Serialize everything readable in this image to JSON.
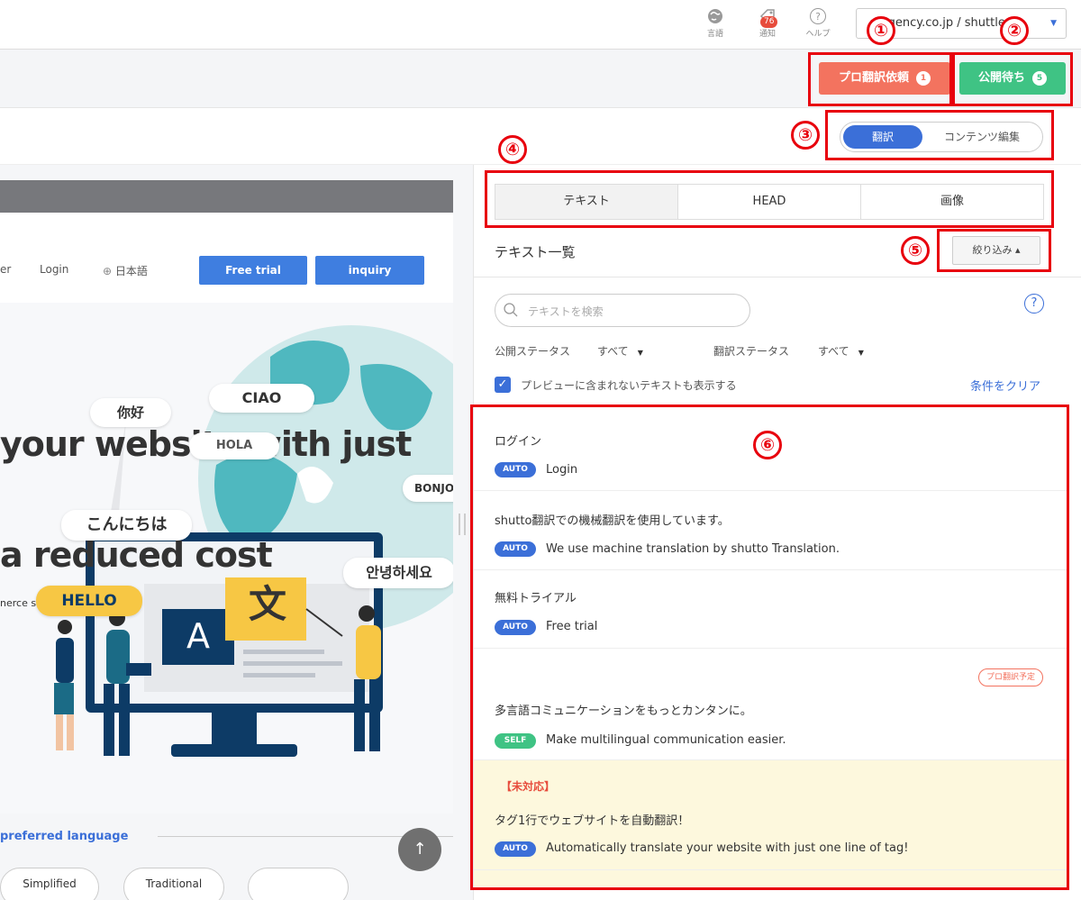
{
  "topbar": {
    "lang_label": "言語",
    "notify_label": "通知",
    "notify_count": "76",
    "help_label": "ヘルプ",
    "site_select": "e-agency.co.jp / shuttle"
  },
  "actions": {
    "pro_label": "プロ翻訳依頼",
    "pro_count": "1",
    "publish_label": "公開待ち",
    "publish_count": "5"
  },
  "mode": {
    "translate": "翻訳",
    "edit": "コンテンツ編集"
  },
  "preview": {
    "nav_partial": "er",
    "nav_login": "Login",
    "nav_lang": "日本語",
    "btn_trial": "Free trial",
    "btn_inquiry": "inquiry",
    "hero_line1": "your website with just",
    "hero_line2": "a reduced cost",
    "hero_sub": "nerce sites, etc.",
    "bubbles": {
      "nihao": "你好",
      "ciao": "CIAO",
      "hola": "HOLA",
      "bonjour": "BONJO",
      "konnichiwa": "こんにちは",
      "annyeong": "안녕하세요",
      "hello": "HELLO",
      "moji": "文",
      "a": "A"
    },
    "pref_lang": "preferred language",
    "chip_simplified": "Simplified",
    "chip_traditional": "Traditional",
    "scroll_up": "↑"
  },
  "tabs": [
    "テキスト",
    "HEAD",
    "画像"
  ],
  "list": {
    "title": "テキスト一覧",
    "filter_label": "絞り込み ▴",
    "search_placeholder": "テキストを検索",
    "help": "?",
    "pub_status_label": "公開ステータス",
    "pub_status_value": "すべて",
    "tr_status_label": "翻訳ステータス",
    "tr_status_value": "すべて",
    "checkbox_label": "プレビューに含まれないテキストも表示する",
    "clear_label": "条件をクリア"
  },
  "items": [
    {
      "source": "ログイン",
      "badge": "AUTO",
      "translation": "Login"
    },
    {
      "source": "shutto翻訳での機械翻訳を使用しています。",
      "badge": "AUTO",
      "translation": "We use machine translation by shutto Translation."
    },
    {
      "source": "無料トライアル",
      "badge": "AUTO",
      "translation": "Free trial"
    },
    {
      "source": "多言語コミュニケーションをもっとカンタンに。",
      "badge": "SELF",
      "translation": "Make multilingual communication easier.",
      "tag": "プロ翻訳予定"
    },
    {
      "warn": "【未対応】",
      "source": "タグ1行でウェブサイトを自動翻訳！",
      "badge": "AUTO",
      "translation": "Automatically translate your website with just one line of tag!"
    }
  ],
  "annotations": [
    "①",
    "②",
    "③",
    "④",
    "⑤",
    "⑥"
  ],
  "colors": {
    "accent": "#3b6fd8",
    "pro": "#f3735f",
    "publish": "#3fc384",
    "annotation": "#e8000d",
    "warn_bg": "#fdf8dd"
  }
}
